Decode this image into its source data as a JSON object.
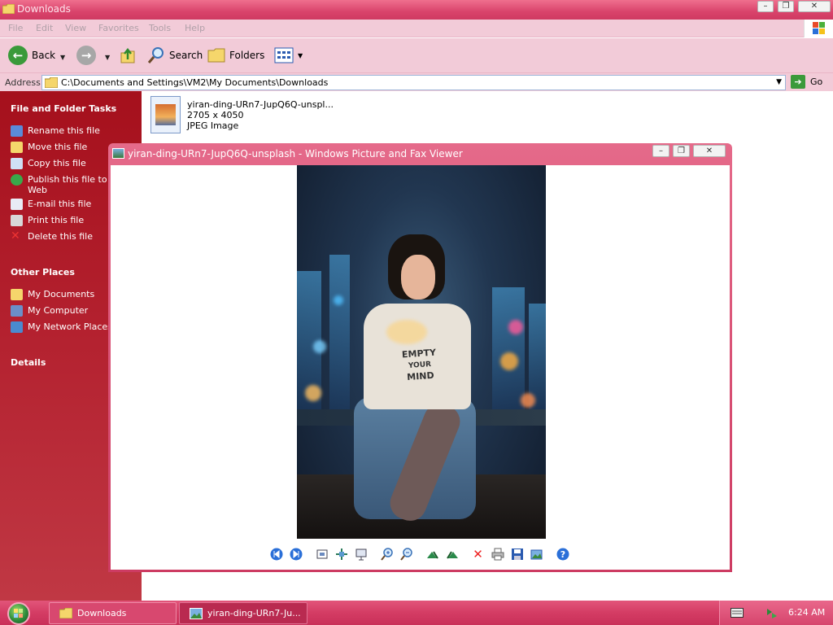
{
  "explorer": {
    "title": "Downloads",
    "menu": [
      "File",
      "Edit",
      "View",
      "Favorites",
      "Tools",
      "Help"
    ],
    "toolbar": {
      "back": "Back",
      "search": "Search",
      "folders": "Folders"
    },
    "address": {
      "label": "Address",
      "path": "C:\\Documents and Settings\\VM2\\My Documents\\Downloads",
      "go": "Go"
    },
    "tasks": {
      "file_heading": "File and Folder Tasks",
      "file_items": [
        "Rename this file",
        "Move this file",
        "Copy this file",
        "Publish this file to the Web",
        "E-mail this file",
        "Print this file",
        "Delete this file"
      ],
      "other_heading": "Other Places",
      "other_items": [
        "My Documents",
        "My Computer",
        "My Network Places"
      ],
      "details_heading": "Details"
    },
    "file": {
      "name": "yiran-ding-URn7-JupQ6Q-unspl...",
      "dimensions": "2705 x 4050",
      "type": "JPEG Image"
    }
  },
  "viewer": {
    "title": "yiran-ding-URn7-JupQ6Q-unsplash - Windows Picture and Fax Viewer",
    "shirt_text": [
      "EMPTY",
      "YOUR",
      "MIND"
    ],
    "toolbar_icons": [
      "previous-image-icon",
      "next-image-icon",
      "best-fit-icon",
      "actual-size-icon",
      "slideshow-icon",
      "zoom-in-icon",
      "zoom-out-icon",
      "rotate-clockwise-icon",
      "rotate-counterclockwise-icon",
      "delete-icon",
      "print-icon",
      "save-icon",
      "edit-icon",
      "help-icon"
    ]
  },
  "taskbar": {
    "buttons": [
      "Downloads",
      "yiran-ding-URn7-Ju..."
    ],
    "clock": "6:24 AM"
  },
  "colors": {
    "accent": "#d43c64",
    "pane": "#a5101c",
    "toolbar_bg": "#f2cbd8"
  }
}
